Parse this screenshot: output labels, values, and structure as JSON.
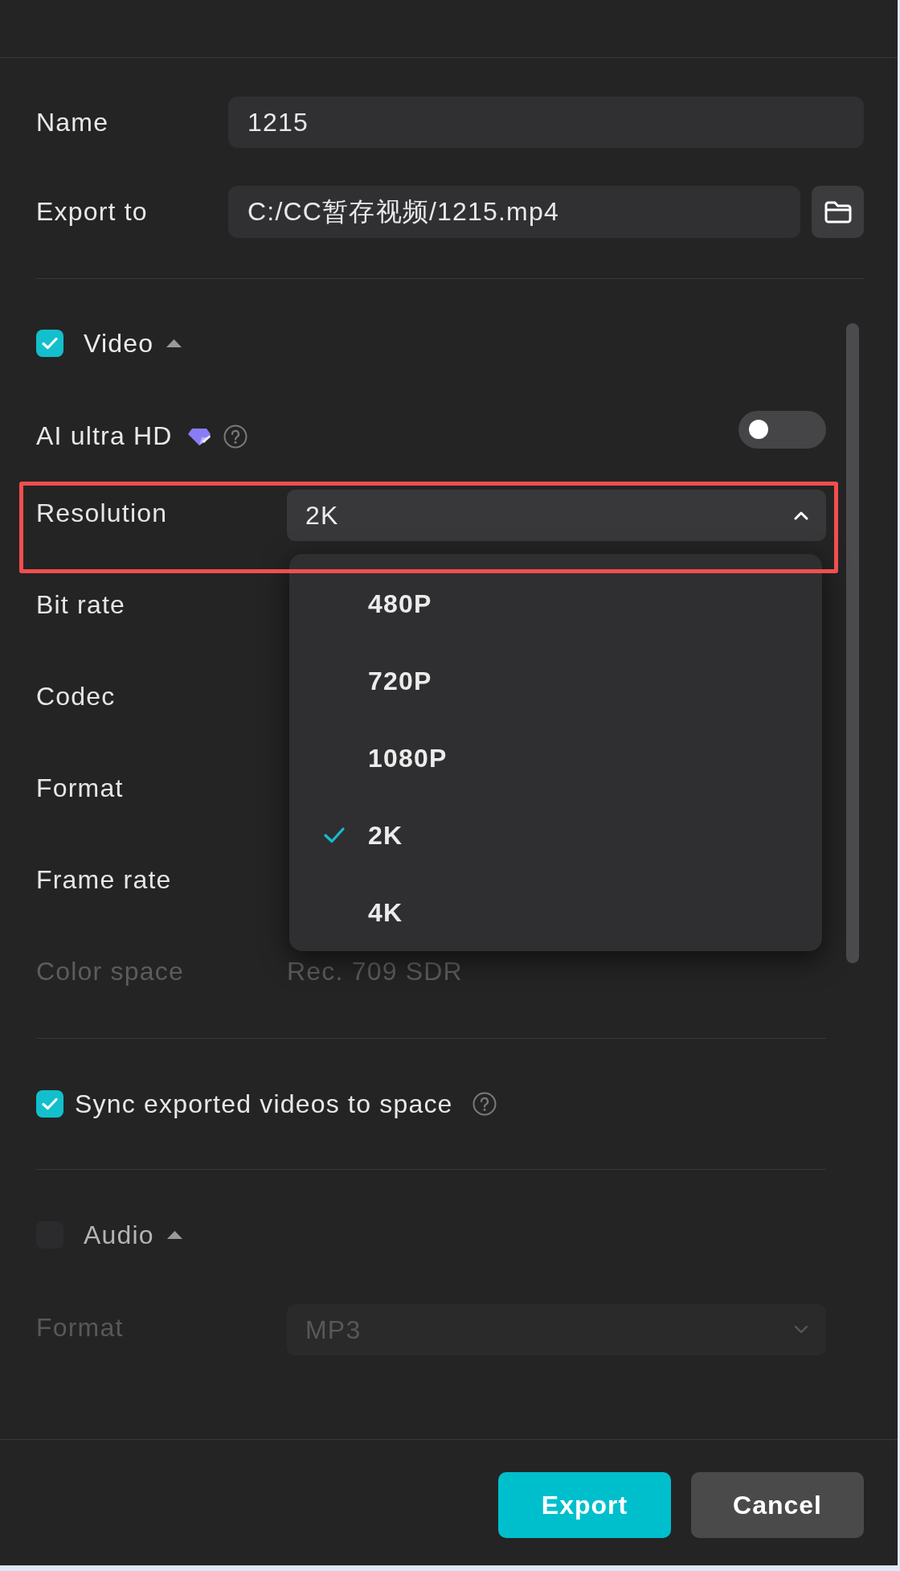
{
  "fields": [
    {
      "kind": "text",
      "label": "Name",
      "value": "1215"
    },
    {
      "kind": "path",
      "label": "Export to",
      "value": "C:/CC暂存视频/1215.mp4"
    }
  ],
  "video": {
    "title": "Video",
    "checked": true,
    "expanded": true,
    "ai_ultra_hd": {
      "label": "AI ultra HD",
      "on": false
    },
    "settings": [
      {
        "kind": "select",
        "label": "Resolution",
        "value": "2K",
        "expanded": true,
        "highlighted": true,
        "disabled": false,
        "options": [
          {
            "label": "480P",
            "selected": false
          },
          {
            "label": "720P",
            "selected": false
          },
          {
            "label": "1080P",
            "selected": false
          },
          {
            "label": "2K",
            "selected": true
          },
          {
            "label": "4K",
            "selected": false
          }
        ]
      },
      {
        "label": "Bit rate",
        "highlighted": false,
        "disabled": false
      },
      {
        "label": "Codec",
        "highlighted": false,
        "disabled": false
      },
      {
        "label": "Format",
        "highlighted": false,
        "disabled": false
      },
      {
        "label": "Frame rate",
        "highlighted": false,
        "disabled": false
      },
      {
        "kind": "text",
        "label": "Color space",
        "value": "Rec. 709 SDR",
        "highlighted": false,
        "disabled": true
      }
    ]
  },
  "sync": {
    "label": "Sync exported videos to space",
    "checked": true
  },
  "audio": {
    "title": "Audio",
    "checked": false,
    "expanded": true,
    "settings": [
      {
        "kind": "select",
        "label": "Format",
        "value": "MP3",
        "expanded": false,
        "highlighted": false,
        "disabled": true
      }
    ]
  },
  "buttons": [
    {
      "kind": "primary",
      "label": "Export"
    },
    {
      "kind": "secondary",
      "label": "Cancel"
    }
  ]
}
